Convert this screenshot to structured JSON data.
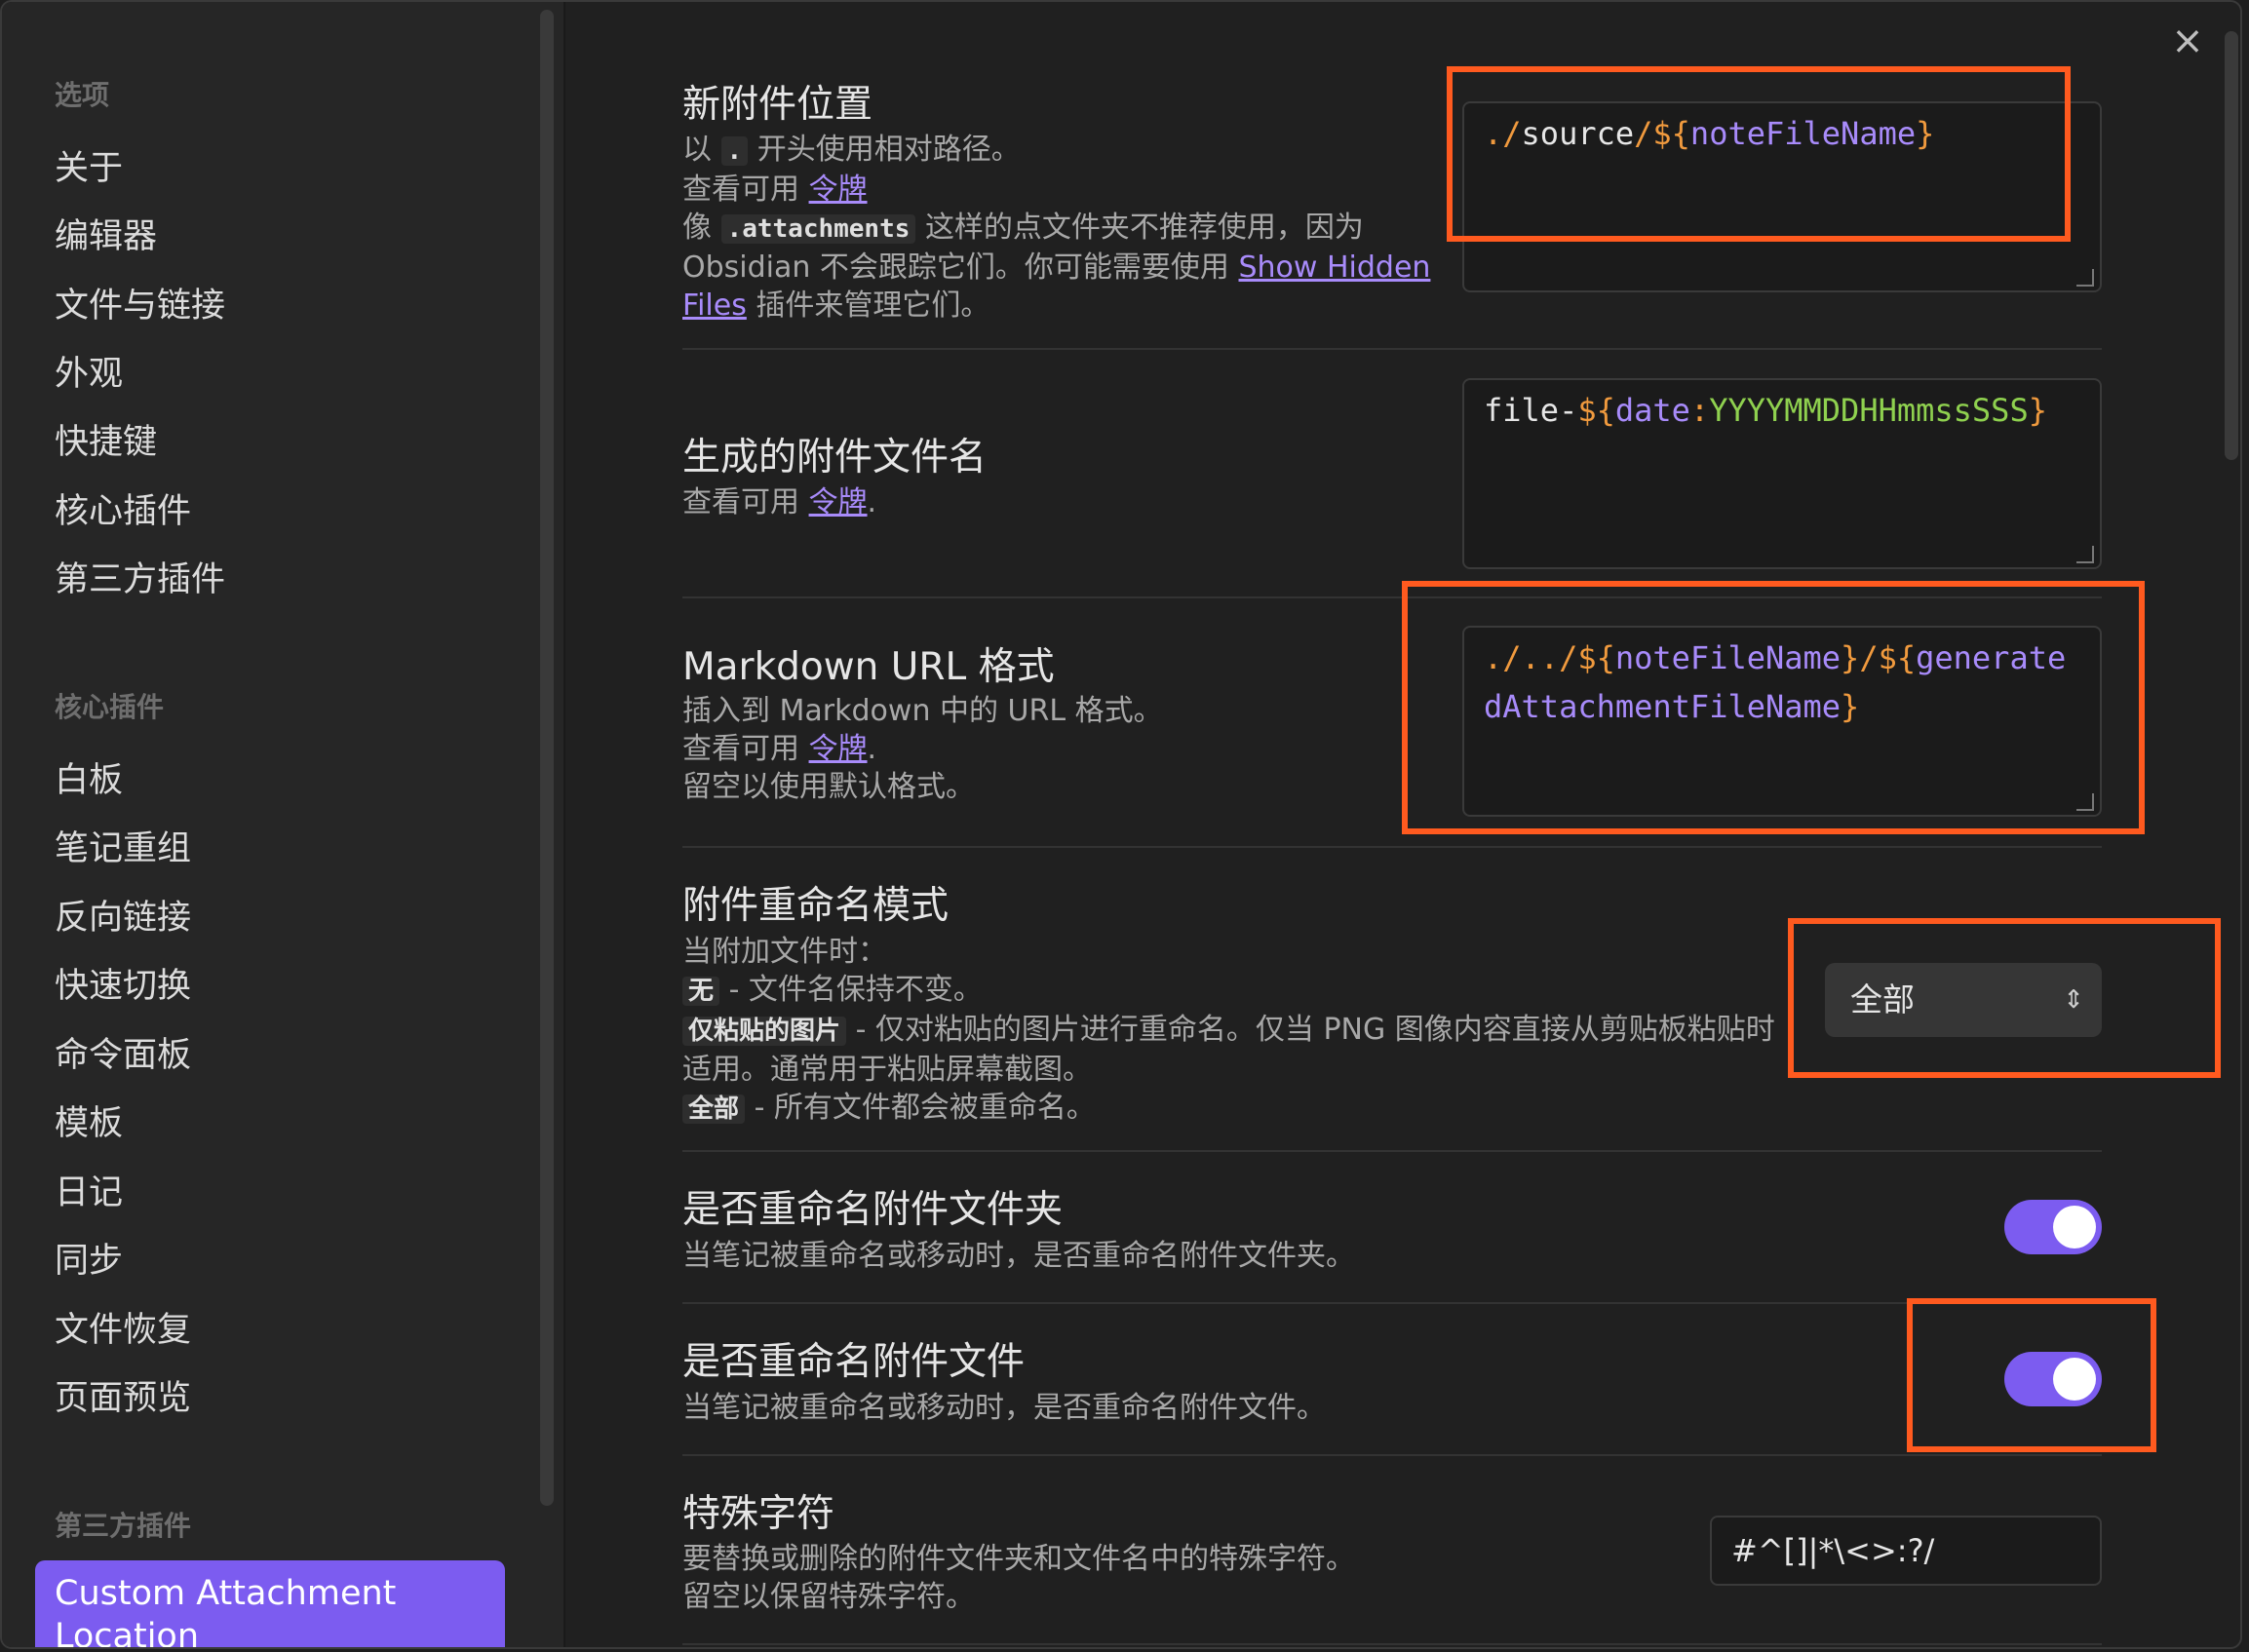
{
  "sidebar": {
    "section_options": "选项",
    "options": [
      "关于",
      "编辑器",
      "文件与链接",
      "外观",
      "快捷键",
      "核心插件",
      "第三方插件"
    ],
    "section_core": "核心插件",
    "core": [
      "白板",
      "笔记重组",
      "反向链接",
      "快速切换",
      "命令面板",
      "模板",
      "日记",
      "同步",
      "文件恢复",
      "页面预览"
    ],
    "section_community": "第三方插件",
    "active_plugin": "Custom Attachment Location"
  },
  "close_icon": "×",
  "settings": {
    "location": {
      "name": "新附件位置",
      "desc1_pre": "以",
      "desc1_code": ".",
      "desc1_post": "开头使用相对路径。",
      "desc2_pre": "查看可用",
      "desc2_link": "令牌",
      "desc3_pre": "像",
      "desc3_code": ".attachments",
      "desc3_post": "这样的点文件夹不推荐使用，因为",
      "desc4_pre": "Obsidian 不会跟踪它们。你可能需要使用",
      "desc4_link": "Show Hidden",
      "desc5_link": "Files",
      "desc5_post": "插件来管理它们。",
      "value_tokens": [
        {
          "t": "./",
          "c": "punc"
        },
        {
          "t": "source",
          "c": "plain"
        },
        {
          "t": "/",
          "c": "punc"
        },
        {
          "t": "${",
          "c": "punc"
        },
        {
          "t": "noteFileName",
          "c": "var"
        },
        {
          "t": "}",
          "c": "punc"
        }
      ]
    },
    "filename": {
      "name": "生成的附件文件名",
      "desc_pre": "查看可用",
      "desc_link": "令牌",
      "desc_post": ".",
      "value_tokens": [
        {
          "t": "file-",
          "c": "plain"
        },
        {
          "t": "${",
          "c": "punc"
        },
        {
          "t": "date",
          "c": "var"
        },
        {
          "t": ":",
          "c": "punc"
        },
        {
          "t": "YYYYMMDDHHmmssSSS",
          "c": "fmt"
        },
        {
          "t": "}",
          "c": "punc"
        }
      ]
    },
    "markdown_url": {
      "name": "Markdown URL 格式",
      "desc1": "插入到 Markdown 中的 URL 格式。",
      "desc2_pre": "查看可用",
      "desc2_link": "令牌",
      "desc2_post": ".",
      "desc3": "留空以使用默认格式。",
      "value_tokens": [
        {
          "t": "./../",
          "c": "punc"
        },
        {
          "t": "${",
          "c": "punc"
        },
        {
          "t": "noteFileName",
          "c": "var"
        },
        {
          "t": "}",
          "c": "punc"
        },
        {
          "t": "/",
          "c": "punc"
        },
        {
          "t": "${",
          "c": "punc"
        },
        {
          "t": "generatedAttachmentFileName",
          "c": "var"
        },
        {
          "t": "}",
          "c": "punc"
        }
      ]
    },
    "rename_mode": {
      "name": "附件重命名模式",
      "desc1": "当附加文件时：",
      "opt1_code": "无",
      "opt1_text": "- 文件名保持不变。",
      "opt2_code": "仅粘贴的图片",
      "opt2_text": "- 仅对粘贴的图片进行重命名。仅当 PNG 图像内容直接从剪贴板粘贴时",
      "opt2_cont": "适用。通常用于粘贴屏幕截图。",
      "opt3_code": "全部",
      "opt3_text": "- 所有文件都会被重命名。",
      "selected": "全部"
    },
    "rename_folder": {
      "name": "是否重命名附件文件夹",
      "desc": "当笔记被重命名或移动时，是否重命名附件文件夹。",
      "enabled": true
    },
    "rename_file": {
      "name": "是否重命名附件文件",
      "desc": "当笔记被重命名或移动时，是否重命名附件文件。",
      "enabled": true
    },
    "special_chars": {
      "name": "特殊字符",
      "desc1": "要替换或删除的附件文件夹和文件名中的特殊字符。",
      "desc2": "留空以保留特殊字符。",
      "value": "#^[]|*\\<>:?/"
    }
  },
  "colors": {
    "accent": "#7c5cf0",
    "highlight": "#ff5a1f",
    "token_punc": "#f09a3e",
    "token_var": "#a88bfa",
    "token_fmt": "#8fd14f"
  }
}
